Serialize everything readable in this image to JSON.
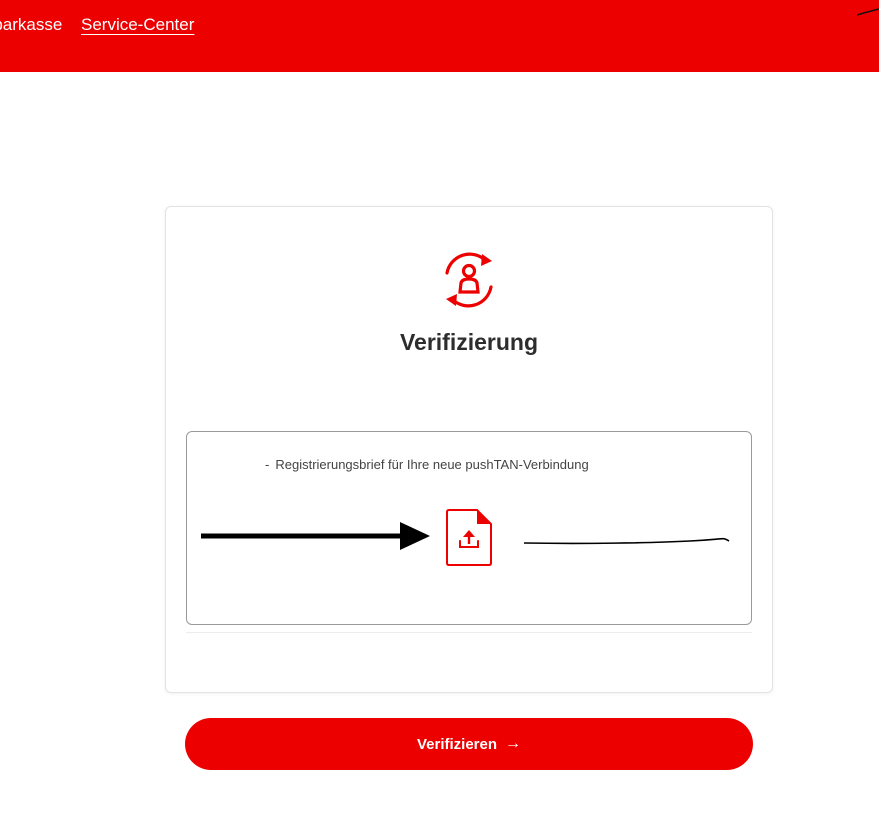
{
  "header": {
    "bg_color": "#ec0000",
    "nav": [
      {
        "label": "Sparkasse"
      },
      {
        "label": "Service-Center",
        "active": true
      }
    ]
  },
  "card": {
    "icon": "user-refresh-icon",
    "title": "Verifizierung",
    "documents": [
      {
        "dash": "-",
        "label": "Registrierungsbrief für Ihre neue pushTAN-Verbindung"
      }
    ],
    "upload_icon": "document-upload-icon"
  },
  "button": {
    "label": "Verifizieren",
    "arrow": "→"
  },
  "colors": {
    "accent": "#ec0000",
    "text": "#2d2d2d",
    "border": "#9a9a9a"
  }
}
